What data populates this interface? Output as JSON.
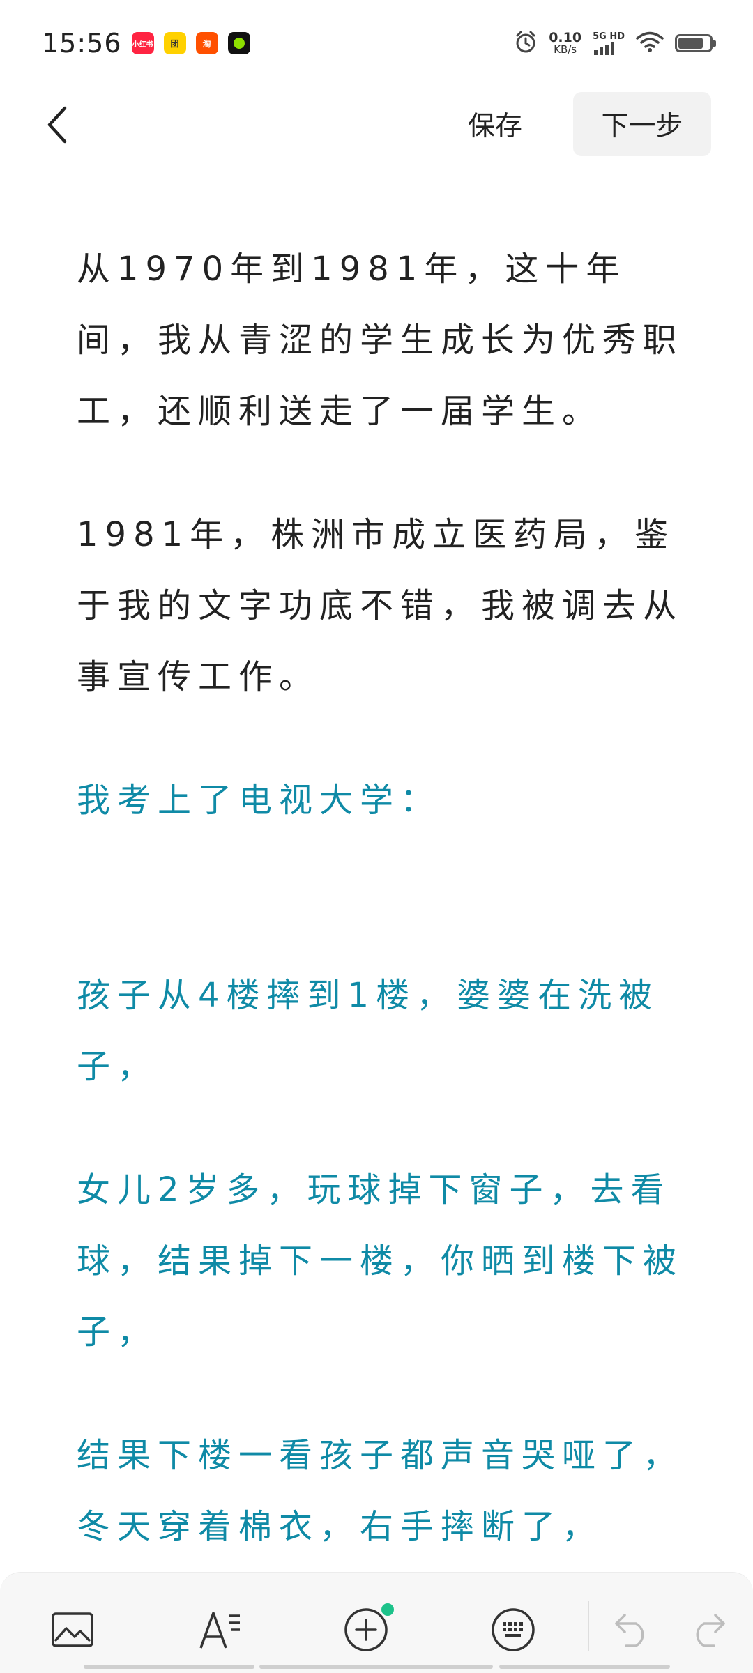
{
  "status_bar": {
    "time": "15:56",
    "app_badges": [
      {
        "name": "xiaohongshu-badge",
        "text": "小红书",
        "color": "#ff2442"
      },
      {
        "name": "meituan-badge",
        "text": "团",
        "color": "#ffd100"
      },
      {
        "name": "taobao-badge",
        "text": "淘",
        "color": "#ff5000"
      },
      {
        "name": "green-app-badge",
        "text": "",
        "color": "#111111"
      }
    ],
    "net_speed_value": "0.10",
    "net_speed_unit": "KB/s",
    "network_label": "5G HD"
  },
  "top_bar": {
    "save_label": "保存",
    "next_label": "下一步"
  },
  "content": {
    "paragraphs": [
      {
        "text": "从1970年到1981年，这十年间，我从青涩的学生成长为优秀职工，还顺利送走了一届学生。",
        "style": "normal"
      },
      {
        "text": "1981年，株洲市成立医药局，鉴于我的文字功底不错，我被调去从事宣传工作。",
        "style": "normal"
      },
      {
        "text": "我考上了电视大学：",
        "style": "teal"
      },
      {
        "text": "孩子从4楼摔到1楼，婆婆在洗被子，",
        "style": "teal"
      },
      {
        "text": "女儿2岁多，玩球掉下窗子，去看球，结果掉下一楼，你晒到楼下被子，",
        "style": "teal"
      },
      {
        "text": "结果下楼一看孩子都声音哭哑了，冬天穿着棉衣，右手摔断了，",
        "style": "teal"
      }
    ]
  },
  "toolbar": {
    "items": [
      "image-icon",
      "text-format-icon",
      "add-circle-icon",
      "keyboard-icon",
      "undo-icon",
      "redo-icon"
    ],
    "accent_dot_color": "#1cc28a"
  },
  "colors": {
    "teal_text": "#0f8aa6",
    "body_text": "#222222"
  }
}
